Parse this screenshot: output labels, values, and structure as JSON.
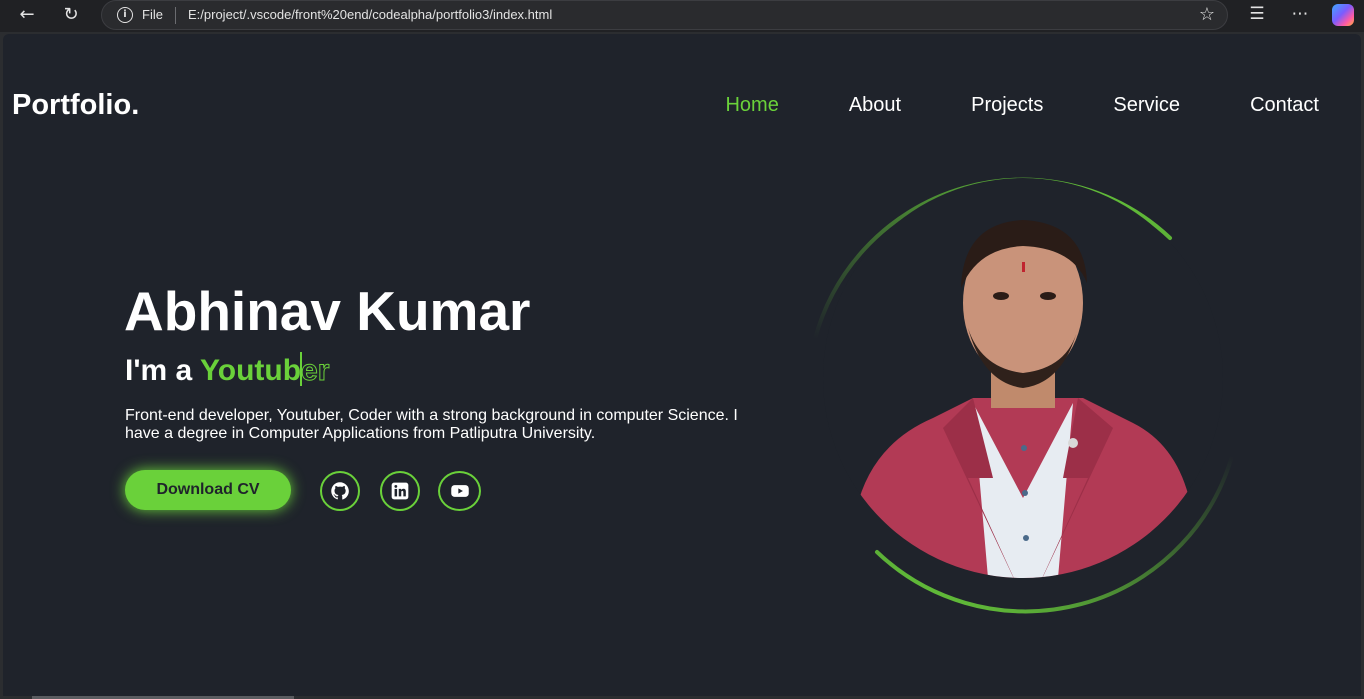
{
  "browser": {
    "url_scheme": "File",
    "url": "E:/project/.vscode/front%20end/codealpha/portfolio3/index.html",
    "icons": [
      "back-arrow-icon",
      "refresh-icon",
      "info-icon",
      "star-icon",
      "favorites-icon",
      "more-icon",
      "copilot-icon"
    ]
  },
  "site": {
    "logo": "Portfolio.",
    "nav": [
      {
        "label": "Home",
        "active": true
      },
      {
        "label": "About",
        "active": false
      },
      {
        "label": "Projects",
        "active": false
      },
      {
        "label": "Service",
        "active": false
      },
      {
        "label": "Contact",
        "active": false
      }
    ]
  },
  "hero": {
    "name": "Abhinav Kumar",
    "role_prefix": "I'm a ",
    "role_typed": "Youtub",
    "role_remaining": "er",
    "description": "Front-end developer, Youtuber, Coder with a strong background in computer Science. I have a degree in Computer Applications from Patliputra University.",
    "cta_label": "Download CV",
    "socials": [
      "github-icon",
      "linkedin-icon",
      "youtube-icon"
    ]
  },
  "colors": {
    "accent": "#6ad13a",
    "background": "#1f232b",
    "text": "#ffffff",
    "jacket": "#b23a55"
  }
}
